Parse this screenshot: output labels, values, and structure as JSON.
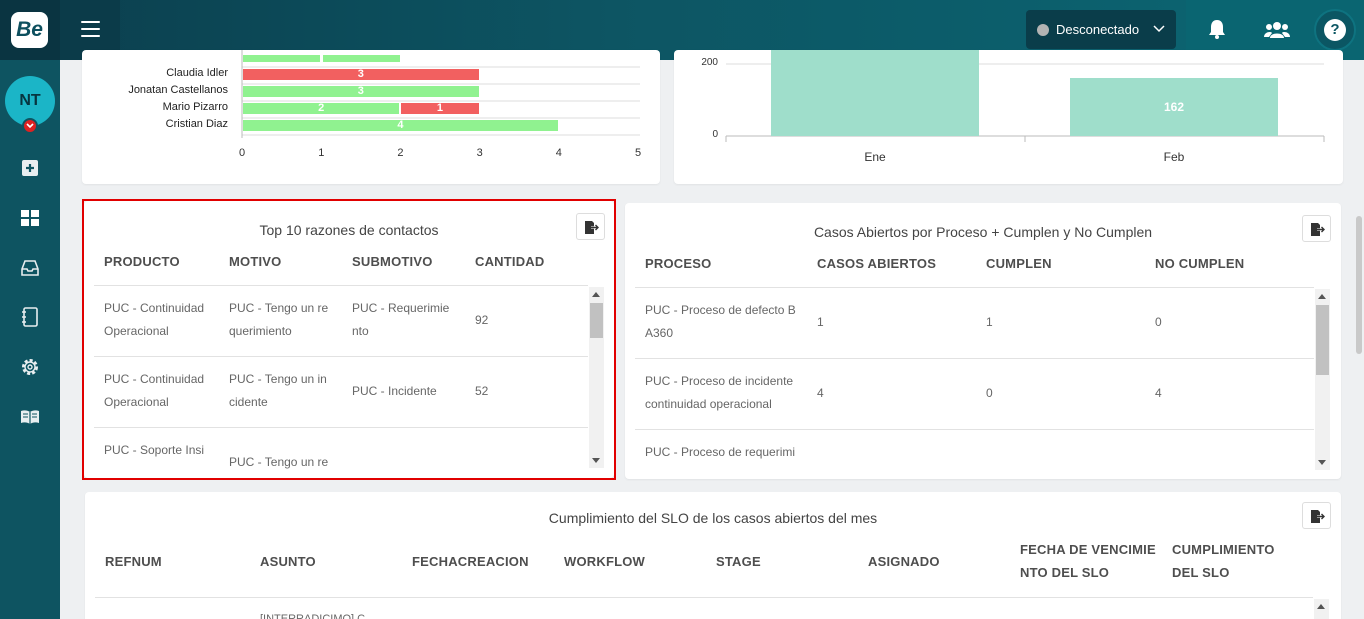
{
  "app": {
    "logo": "Be"
  },
  "header": {
    "status_label": "Desconectado",
    "status_color": "#b3b3b3",
    "help_label": "?"
  },
  "sidebar": {
    "avatar_initials": "NT",
    "items": [
      "plus-square-icon",
      "dashboard-grid-icon",
      "inbox-icon",
      "notebook-icon",
      "gear-icon",
      "book-icon"
    ]
  },
  "agent_chart": {
    "chart_data": {
      "type": "bar",
      "orientation": "horizontal",
      "stacked": true,
      "categories": [
        "Claudia Idler",
        "Jonatan Castellanos",
        "Mario Pizarro",
        "Cristian Diaz"
      ],
      "series": [
        {
          "color": "#90f290",
          "values": [
            0,
            3,
            2,
            4
          ],
          "labels": [
            "",
            "3",
            "2",
            "4"
          ]
        },
        {
          "color": "#f26060",
          "values": [
            3,
            0,
            1,
            0
          ],
          "labels": [
            "3",
            "",
            "1",
            ""
          ]
        }
      ],
      "xlim": [
        0,
        5
      ],
      "xticks": [
        "0",
        "1",
        "2",
        "3",
        "4",
        "5"
      ]
    }
  },
  "month_chart": {
    "chart_data": {
      "type": "bar",
      "categories": [
        "Ene",
        "Feb"
      ],
      "values": [
        300,
        162
      ],
      "data_labels": [
        "",
        "162"
      ],
      "yticks": [
        "0",
        "200"
      ],
      "color": "#9fdecb"
    }
  },
  "top10": {
    "title": "Top 10 razones de contactos",
    "columns": [
      "PRODUCTO",
      "MOTIVO",
      "SUBMOTIVO",
      "CANTIDAD"
    ],
    "rows": [
      [
        "PUC - Continuidad Operacional",
        "PUC - Tengo un re querimiento",
        "PUC - Requerimie nto",
        "92"
      ],
      [
        "PUC - Continuidad Operacional",
        "PUC - Tengo un in cidente",
        "PUC - Incidente",
        "52"
      ],
      [
        "PUC - Soporte Insi",
        "PUC - Tengo un re",
        "",
        ""
      ]
    ]
  },
  "casos": {
    "title": "Casos Abiertos por Proceso + Cumplen y No Cumplen",
    "columns": [
      "PROCESO",
      "CASOS ABIERTOS",
      "CUMPLEN",
      "NO CUMPLEN"
    ],
    "rows": [
      [
        "PUC - Proceso de defecto B A360",
        "1",
        "1",
        "0"
      ],
      [
        "PUC - Proceso de incidente continuidad operacional",
        "4",
        "0",
        "4"
      ],
      [
        "PUC - Proceso de requerimi",
        "",
        "",
        ""
      ]
    ]
  },
  "slo": {
    "title": "Cumplimiento del SLO de los casos abiertos del mes",
    "columns": [
      "REFNUM",
      "ASUNTO",
      "FECHACREACION",
      "WORKFLOW",
      "STAGE",
      "ASIGNADO",
      "FECHA DE VENCIMIE NTO DEL SLO",
      "CUMPLIMIENTO DEL SLO"
    ],
    "partial_cell": "[INTERRADICIMO] C..."
  }
}
